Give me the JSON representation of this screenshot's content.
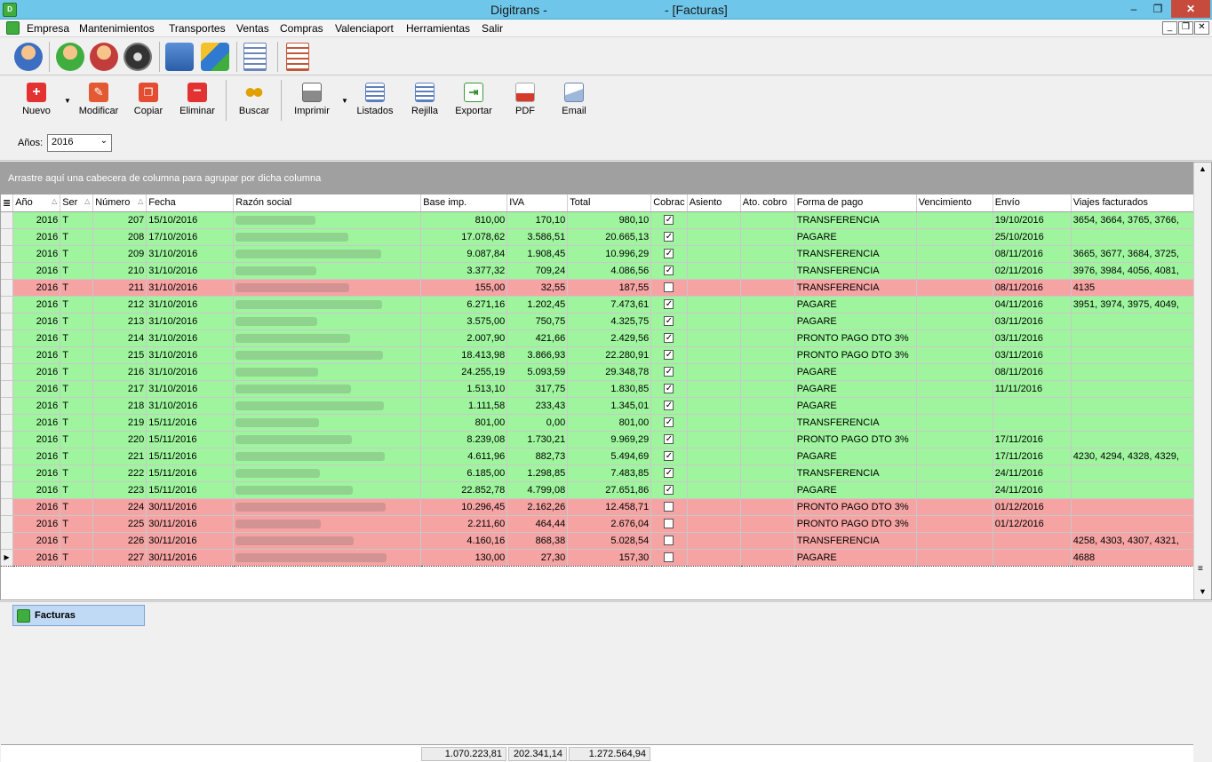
{
  "window": {
    "title_left": "Digitrans -",
    "title_right": "- [Facturas]",
    "minimize": "–",
    "maximize": "❐",
    "close": "✕"
  },
  "menu": [
    "Empresa",
    "Mantenimientos",
    "Transportes",
    "Ventas",
    "Compras",
    "Valenciaport",
    "Herramientas",
    "Salir"
  ],
  "mdi_controls": [
    "_",
    "❐",
    "✕"
  ],
  "toolbar": {
    "nuevo": "Nuevo",
    "modificar": "Modificar",
    "copiar": "Copiar",
    "eliminar": "Eliminar",
    "buscar": "Buscar",
    "imprimir": "Imprimir",
    "listados": "Listados",
    "rejilla": "Rejilla",
    "exportar": "Exportar",
    "pdf": "PDF",
    "email": "Email"
  },
  "filter": {
    "years_label": "Años:",
    "years_value": "2016"
  },
  "group_panel": "Arrastre aquí una cabecera de columna para agrupar por dicha columna",
  "columns": [
    "Año",
    "Ser",
    "Número",
    "Fecha",
    "Razón social",
    "Base imp.",
    "IVA",
    "Total",
    "Cobrac",
    "Asiento",
    "Ato. cobro",
    "Forma de pago",
    "Vencimiento",
    "Envío",
    "Viajes facturados"
  ],
  "rows": [
    {
      "anio": "2016",
      "serie": "T",
      "numero": "207",
      "fecha": "15/10/2016",
      "base": "810,00",
      "iva": "170,10",
      "total": "980,10",
      "cobrado": true,
      "forma": "TRANSFERENCIA",
      "envio": "19/10/2016",
      "viajes": "3654, 3664, 3765, 3766,"
    },
    {
      "anio": "2016",
      "serie": "T",
      "numero": "208",
      "fecha": "17/10/2016",
      "base": "17.078,62",
      "iva": "3.586,51",
      "total": "20.665,13",
      "cobrado": true,
      "forma": "PAGARE",
      "envio": "25/10/2016",
      "viajes": ""
    },
    {
      "anio": "2016",
      "serie": "T",
      "numero": "209",
      "fecha": "31/10/2016",
      "base": "9.087,84",
      "iva": "1.908,45",
      "total": "10.996,29",
      "cobrado": true,
      "forma": "TRANSFERENCIA",
      "envio": "08/11/2016",
      "viajes": "3665, 3677, 3684, 3725,"
    },
    {
      "anio": "2016",
      "serie": "T",
      "numero": "210",
      "fecha": "31/10/2016",
      "base": "3.377,32",
      "iva": "709,24",
      "total": "4.086,56",
      "cobrado": true,
      "forma": "TRANSFERENCIA",
      "envio": "02/11/2016",
      "viajes": "3976, 3984, 4056, 4081,"
    },
    {
      "anio": "2016",
      "serie": "T",
      "numero": "211",
      "fecha": "31/10/2016",
      "base": "155,00",
      "iva": "32,55",
      "total": "187,55",
      "cobrado": false,
      "forma": "TRANSFERENCIA",
      "envio": "08/11/2016",
      "viajes": "4135"
    },
    {
      "anio": "2016",
      "serie": "T",
      "numero": "212",
      "fecha": "31/10/2016",
      "base": "6.271,16",
      "iva": "1.202,45",
      "total": "7.473,61",
      "cobrado": true,
      "forma": "PAGARE",
      "envio": "04/11/2016",
      "viajes": "3951, 3974, 3975, 4049,"
    },
    {
      "anio": "2016",
      "serie": "T",
      "numero": "213",
      "fecha": "31/10/2016",
      "base": "3.575,00",
      "iva": "750,75",
      "total": "4.325,75",
      "cobrado": true,
      "forma": "PAGARE",
      "envio": "03/11/2016",
      "viajes": ""
    },
    {
      "anio": "2016",
      "serie": "T",
      "numero": "214",
      "fecha": "31/10/2016",
      "base": "2.007,90",
      "iva": "421,66",
      "total": "2.429,56",
      "cobrado": true,
      "forma": "PRONTO PAGO DTO 3%",
      "envio": "03/11/2016",
      "viajes": ""
    },
    {
      "anio": "2016",
      "serie": "T",
      "numero": "215",
      "fecha": "31/10/2016",
      "base": "18.413,98",
      "iva": "3.866,93",
      "total": "22.280,91",
      "cobrado": true,
      "forma": "PRONTO PAGO DTO 3%",
      "envio": "03/11/2016",
      "viajes": ""
    },
    {
      "anio": "2016",
      "serie": "T",
      "numero": "216",
      "fecha": "31/10/2016",
      "base": "24.255,19",
      "iva": "5.093,59",
      "total": "29.348,78",
      "cobrado": true,
      "forma": "PAGARE",
      "envio": "08/11/2016",
      "viajes": ""
    },
    {
      "anio": "2016",
      "serie": "T",
      "numero": "217",
      "fecha": "31/10/2016",
      "base": "1.513,10",
      "iva": "317,75",
      "total": "1.830,85",
      "cobrado": true,
      "forma": "PAGARE",
      "envio": "11/11/2016",
      "viajes": ""
    },
    {
      "anio": "2016",
      "serie": "T",
      "numero": "218",
      "fecha": "31/10/2016",
      "base": "1.111,58",
      "iva": "233,43",
      "total": "1.345,01",
      "cobrado": true,
      "forma": "PAGARE",
      "envio": "",
      "viajes": ""
    },
    {
      "anio": "2016",
      "serie": "T",
      "numero": "219",
      "fecha": "15/11/2016",
      "base": "801,00",
      "iva": "0,00",
      "total": "801,00",
      "cobrado": true,
      "forma": "TRANSFERENCIA",
      "envio": "",
      "viajes": ""
    },
    {
      "anio": "2016",
      "serie": "T",
      "numero": "220",
      "fecha": "15/11/2016",
      "base": "8.239,08",
      "iva": "1.730,21",
      "total": "9.969,29",
      "cobrado": true,
      "forma": "PRONTO PAGO DTO 3%",
      "envio": "17/11/2016",
      "viajes": ""
    },
    {
      "anio": "2016",
      "serie": "T",
      "numero": "221",
      "fecha": "15/11/2016",
      "base": "4.611,96",
      "iva": "882,73",
      "total": "5.494,69",
      "cobrado": true,
      "forma": "PAGARE",
      "envio": "17/11/2016",
      "viajes": "4230, 4294, 4328, 4329,"
    },
    {
      "anio": "2016",
      "serie": "T",
      "numero": "222",
      "fecha": "15/11/2016",
      "base": "6.185,00",
      "iva": "1.298,85",
      "total": "7.483,85",
      "cobrado": true,
      "forma": "TRANSFERENCIA",
      "envio": "24/11/2016",
      "viajes": ""
    },
    {
      "anio": "2016",
      "serie": "T",
      "numero": "223",
      "fecha": "15/11/2016",
      "base": "22.852,78",
      "iva": "4.799,08",
      "total": "27.651,86",
      "cobrado": true,
      "forma": "PAGARE",
      "envio": "24/11/2016",
      "viajes": ""
    },
    {
      "anio": "2016",
      "serie": "T",
      "numero": "224",
      "fecha": "30/11/2016",
      "base": "10.296,45",
      "iva": "2.162,26",
      "total": "12.458,71",
      "cobrado": false,
      "forma": "PRONTO PAGO DTO 3%",
      "envio": "01/12/2016",
      "viajes": ""
    },
    {
      "anio": "2016",
      "serie": "T",
      "numero": "225",
      "fecha": "30/11/2016",
      "base": "2.211,60",
      "iva": "464,44",
      "total": "2.676,04",
      "cobrado": false,
      "forma": "PRONTO PAGO DTO 3%",
      "envio": "01/12/2016",
      "viajes": ""
    },
    {
      "anio": "2016",
      "serie": "T",
      "numero": "226",
      "fecha": "30/11/2016",
      "base": "4.160,16",
      "iva": "868,38",
      "total": "5.028,54",
      "cobrado": false,
      "forma": "TRANSFERENCIA",
      "envio": "",
      "viajes": "4258, 4303, 4307, 4321,"
    },
    {
      "anio": "2016",
      "serie": "T",
      "numero": "227",
      "fecha": "30/11/2016",
      "base": "130,00",
      "iva": "27,30",
      "total": "157,30",
      "cobrado": false,
      "forma": "PAGARE",
      "envio": "",
      "viajes": "4688"
    }
  ],
  "totals": {
    "base": "1.070.223,81",
    "iva": "202.341,14",
    "total": "1.272.564,94"
  },
  "taskbar": {
    "tab": "Facturas"
  },
  "colors": {
    "paid_row": "#9ef59e",
    "unpaid_row": "#f5a3a3",
    "titlebar": "#6ec6ea"
  }
}
